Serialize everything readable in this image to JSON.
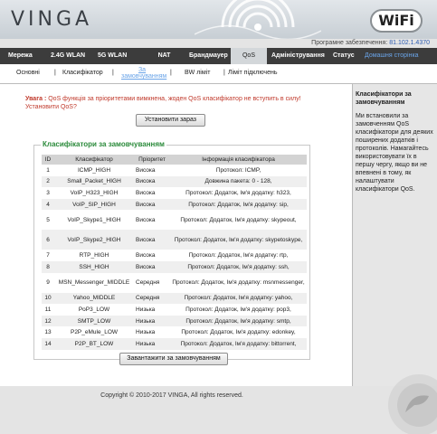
{
  "header": {
    "logo": "VINGA",
    "wifi_badge": "WiFi",
    "firmware_label": "Програмне забезпечення:",
    "firmware_version": "81.102.1.4370"
  },
  "mainnav": [
    {
      "label": "Мережа",
      "name": "nav-network"
    },
    {
      "label": "2.4G WLAN",
      "name": "nav-wlan24"
    },
    {
      "label": "5G WLAN",
      "name": "nav-wlan5"
    },
    {
      "label": "NAT",
      "name": "nav-nat"
    },
    {
      "label": "Брандмауер",
      "name": "nav-firewall"
    },
    {
      "label": "QoS",
      "name": "nav-qos"
    },
    {
      "label": "Адміністрування",
      "name": "nav-admin"
    },
    {
      "label": "Статус",
      "name": "nav-status"
    },
    {
      "label": "Домашня сторінка",
      "name": "nav-home"
    }
  ],
  "subnav": {
    "basic": "Основні",
    "classifier": "Класифікатор",
    "custom_line1": "За",
    "custom_line2": "замовчуванням",
    "bw_limit": "BW ліміт",
    "conn_limit": "Ліміт підключень",
    "sep": "|"
  },
  "warning": {
    "bold": "Увага :",
    "text": "QoS функція за пріоритетами вимкнена, жоден QoS класифікатор не вступить в силу! Установити QoS?"
  },
  "buttons": {
    "set_now": "Установити зараз",
    "upload_default": "Завантажити за замовчуванням"
  },
  "classifiers": {
    "legend": "Класифікатори за замовчуванням",
    "headers": [
      "ID",
      "Класифікатор",
      "Пріоритет",
      "Інформація класифікатора"
    ],
    "rows": [
      {
        "id": "1",
        "name": "ICMP_HIGH",
        "priority": "Висока",
        "info": "Протокол: ICMP,"
      },
      {
        "id": "2",
        "name": "Small_Packet_HIGH",
        "priority": "Висока",
        "info": "Довжина пакета: 0 - 128,"
      },
      {
        "id": "3",
        "name": "VoIP_H323_HIGH",
        "priority": "Висока",
        "info": "Протокол: Додаток, Ім'я додатку: h323,"
      },
      {
        "id": "4",
        "name": "VoIP_SIP_HIGH",
        "priority": "Висока",
        "info": "Протокол: Додаток, Ім'я додатку: sip,"
      },
      {
        "id": "5",
        "name": "VoIP_Skype1_HIGH",
        "priority": "Висока",
        "info": "Протокол: Додаток, Ім'я додатку: skypeout,"
      },
      {
        "id": "6",
        "name": "VoIP_Skype2_HIGH",
        "priority": "Висока",
        "info": "Протокол: Додаток, Ім'я додатку: skypetoskype,"
      },
      {
        "id": "7",
        "name": "RTP_HIGH",
        "priority": "Висока",
        "info": "Протокол: Додаток, Ім'я додатку: rtp,"
      },
      {
        "id": "8",
        "name": "SSH_HIGH",
        "priority": "Висока",
        "info": "Протокол: Додаток, Ім'я додатку: ssh,"
      },
      {
        "id": "9",
        "name": "MSN_Messenger_MIDDLE",
        "priority": "Середня",
        "info": "Протокол: Додаток, Ім'я додатку: msnmessenger,"
      },
      {
        "id": "10",
        "name": "Yahoo_MIDDLE",
        "priority": "Середня",
        "info": "Протокол: Додаток, Ім'я додатку: yahoo,"
      },
      {
        "id": "11",
        "name": "PoP3_LOW",
        "priority": "Низька",
        "info": "Протокол: Додаток, Ім'я додатку: pop3,"
      },
      {
        "id": "12",
        "name": "SMTP_LOW",
        "priority": "Низька",
        "info": "Протокол: Додаток, Ім'я додатку: smtp,"
      },
      {
        "id": "13",
        "name": "P2P_eMule_LOW",
        "priority": "Низька",
        "info": "Протокол: Додаток, Ім'я додатку: edonkey,"
      },
      {
        "id": "14",
        "name": "P2P_BT_LOW",
        "priority": "Низька",
        "info": "Протокол: Додаток, Ім'я додатку: bittorrent,"
      }
    ]
  },
  "sidebar": {
    "title": "Класифікатори за замовчуванням",
    "text": "Ми встановили за замовченням QoS класифікатори для деяких поширених додатків і протоколів. Намагайтесь використовувати їх в першу чергу, якщо ви не впевнені в тому, як налаштувати класифікатори QoS."
  },
  "footer": {
    "copyright": "Copyright © 2010-2017 VINGA, All rights reserved."
  },
  "colors": {
    "nav_bg": "#3c3c3c",
    "nav_active": "#d3d7da",
    "warning": "#c0392b",
    "legend": "#2a8a3a",
    "link": "#6aa4e8"
  }
}
